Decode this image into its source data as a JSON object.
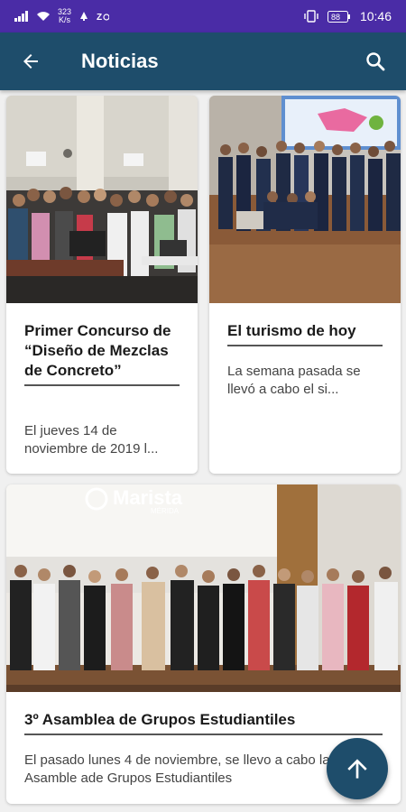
{
  "status_bar": {
    "net_speed_value": "323",
    "net_speed_unit": "K/s",
    "battery": "88",
    "time": "10:46"
  },
  "app_bar": {
    "title": "Noticias",
    "back_icon": "arrow-left-icon",
    "search_icon": "search-icon"
  },
  "news": [
    {
      "title": "Primer Concurso de “Diseño de Mezclas de Concreto”",
      "excerpt": "El jueves 14 de noviembre de 2019 l..."
    },
    {
      "title": "El turismo de hoy",
      "excerpt": "La semana pasada se llevó a cabo el si..."
    },
    {
      "title": "3º Asamblea de Grupos Estudiantiles",
      "excerpt": "El pasado lunes 4 de noviembre, se llevo a cabo la Tercera Asamble ade Grupos Estudiantiles"
    }
  ],
  "photo_text": {
    "banner_logo": "Marista",
    "banner_sub": "MÉRIDA"
  },
  "fab": {
    "icon": "arrow-up-icon"
  },
  "colors": {
    "status_bar": "#4a2ca6",
    "app_bar": "#1e4d6b",
    "fab": "#1e4d6b",
    "background": "#f0f0f0"
  }
}
